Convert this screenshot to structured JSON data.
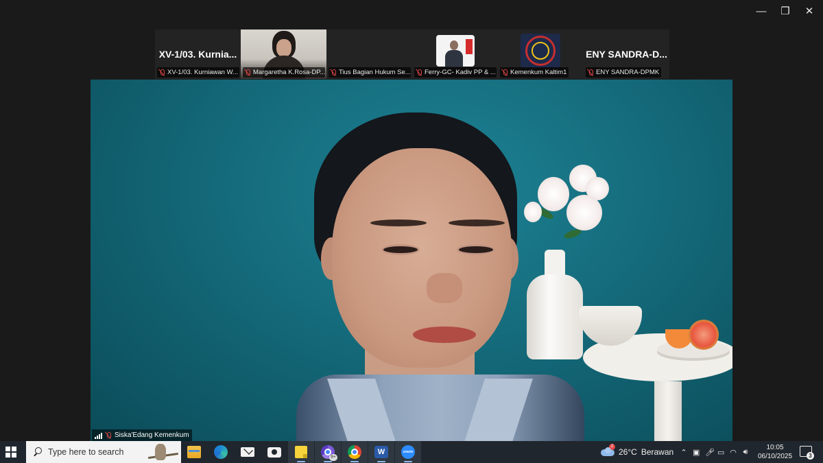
{
  "window": {
    "minimize_icon": "minimize-icon",
    "restore_icon": "restore-icon",
    "close_icon": "close-icon"
  },
  "gallery": [
    {
      "type": "name",
      "big_name": "XV-1/03.  Kurnia...",
      "label": "XV-1/03. Kurniawan W..."
    },
    {
      "type": "video",
      "label": "Margaretha K.Rosa-DP..."
    },
    {
      "type": "blank",
      "label": "Tius Bagian Hukum Se..."
    },
    {
      "type": "card",
      "label": "Ferry-GC- Kadiv PP & ..."
    },
    {
      "type": "logo",
      "label": "Kemenkum Kaltim1"
    },
    {
      "type": "name",
      "big_name": "ENY  SANDRA-D...",
      "label": "ENY SANDRA-DPMK"
    }
  ],
  "main_speaker": {
    "name": "Siska'Edang Kemenkum"
  },
  "taskbar": {
    "search_placeholder": "Type here to search",
    "apps": [
      "File Explorer",
      "Microsoft Edge",
      "Mail",
      "Camera",
      "Sticky Notes",
      "Google Chrome",
      "Google Chrome Profile",
      "Microsoft Word",
      "Zoom"
    ],
    "chrome_badge": "9+",
    "zoom_label": "zoom",
    "word_letter": "W",
    "weather": {
      "alert_count": "2",
      "temp": "26°C",
      "condition": "Berawan"
    },
    "time": "10:05",
    "date": "06/10/2025",
    "notification_count": "3"
  },
  "colors": {
    "accent": "#2d8cff",
    "muted_mic": "#e04545",
    "taskbar_bg": "#20262d",
    "meeting_bg": "#1a1a1a"
  }
}
